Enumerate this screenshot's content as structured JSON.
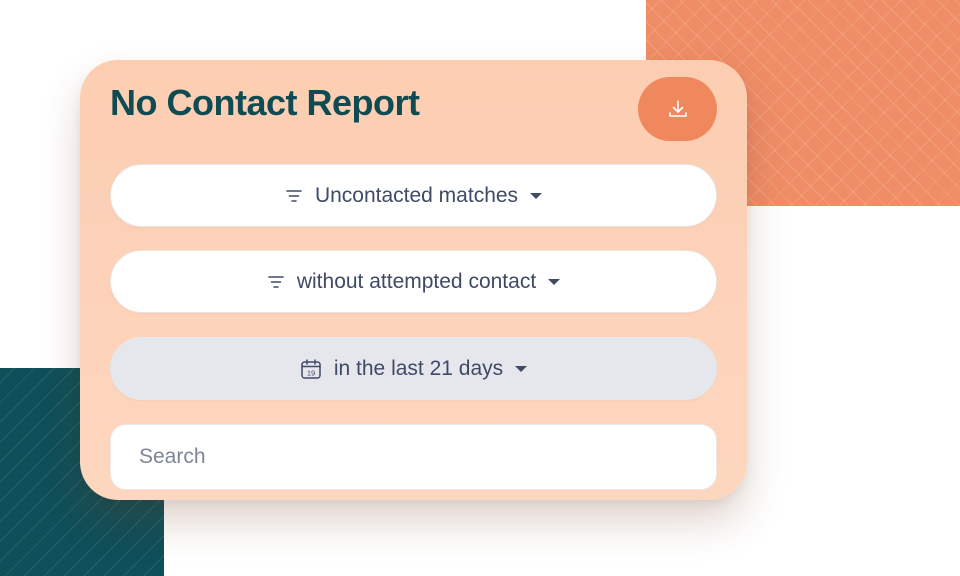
{
  "report": {
    "title": "No Contact Report"
  },
  "actions": {
    "download_icon": "download-icon"
  },
  "filters": [
    {
      "label": "Uncontacted matches",
      "icon": "filter-icon",
      "active": false
    },
    {
      "label": "without attempted contact",
      "icon": "filter-icon",
      "active": false
    },
    {
      "label": "in the last 21 days",
      "icon": "calendar-icon",
      "calendar_day": "19",
      "active": true
    }
  ],
  "search": {
    "placeholder": "Search",
    "value": ""
  },
  "colors": {
    "brand_teal": "#0f4b52",
    "accent_orange": "#f0885d",
    "card_peach": "#fccdb1",
    "text_slate": "#3f4a66"
  }
}
